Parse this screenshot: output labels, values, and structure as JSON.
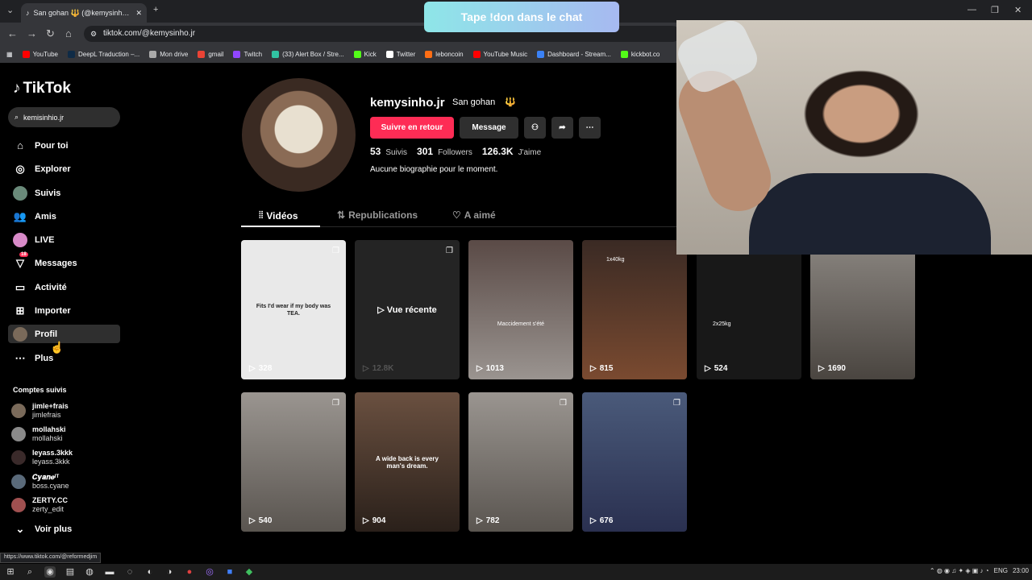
{
  "browser": {
    "tab_title": "San gohan 🔱 (@kemysinho.jr",
    "url": "tiktok.com/@kemysinho.jr",
    "bookmarks": [
      {
        "label": "YouTube",
        "color": "#ff0000"
      },
      {
        "label": "DeepL Traduction –...",
        "color": "#0f2b46"
      },
      {
        "label": "Mon drive",
        "color": "#aaaaaa"
      },
      {
        "label": "gmail",
        "color": "#ea4335"
      },
      {
        "label": "Twitch",
        "color": "#9146ff"
      },
      {
        "label": "(33) Alert Box / Stre...",
        "color": "#31c3a2"
      },
      {
        "label": "Kick",
        "color": "#53fc18"
      },
      {
        "label": "Twitter",
        "color": "#ffffff"
      },
      {
        "label": "leboncoin",
        "color": "#ff6e14"
      },
      {
        "label": "YouTube Music",
        "color": "#ff0000"
      },
      {
        "label": "Dashboard - Stream...",
        "color": "#3b82f6"
      },
      {
        "label": "kickbot.co",
        "color": "#53fc18"
      }
    ],
    "status_url": "https://www.tiktok.com/@reformedjim"
  },
  "overlay": {
    "chat_banner": "Tape !don dans le chat"
  },
  "sidebar": {
    "logo": "TikTok",
    "search_value": "kemisinhio.jr",
    "nav": [
      {
        "label": "Pour toi",
        "icon": "home-icon"
      },
      {
        "label": "Explorer",
        "icon": "compass-icon"
      },
      {
        "label": "Suivis",
        "icon": "avatar"
      },
      {
        "label": "Amis",
        "icon": "friends-icon"
      },
      {
        "label": "LIVE",
        "icon": "live-icon"
      },
      {
        "label": "Messages",
        "icon": "messages-icon",
        "badge": "18"
      },
      {
        "label": "Activité",
        "icon": "activity-icon"
      },
      {
        "label": "Importer",
        "icon": "upload-icon"
      },
      {
        "label": "Profil",
        "icon": "avatar"
      },
      {
        "label": "Plus",
        "icon": "more-icon"
      }
    ],
    "following_title": "Comptes suivis",
    "following": [
      {
        "name": "jimle+frais",
        "handle": "jimlefrais",
        "color": "#7a6a5a"
      },
      {
        "name": "mollahski",
        "handle": "mollahski",
        "color": "#8a8a8a"
      },
      {
        "name": "leyass.3kkk",
        "handle": "leyass.3kkk",
        "color": "#3a2a2a"
      },
      {
        "name": "𝑪𝒚𝒂𝒏𝒆ᴵᵀ",
        "handle": "boss.cyane",
        "color": "#5a6a7a"
      },
      {
        "name": "ZERTY.CC",
        "handle": "zerty_edit",
        "color": "#a05050"
      }
    ],
    "see_more": "Voir plus"
  },
  "profile": {
    "username": "kemysinho.jr",
    "nickname": "San gohan",
    "follow_button": "Suivre en retour",
    "message_button": "Message",
    "following_count": "53",
    "following_label": "Suivis",
    "followers_count": "301",
    "followers_label": "Followers",
    "likes_count": "126.3K",
    "likes_label": "J'aime",
    "bio": "Aucune biographie pour le moment.",
    "tabs": [
      {
        "label": "Vidéos",
        "icon": "grid-icon"
      },
      {
        "label": "Republications",
        "icon": "repost-icon"
      },
      {
        "label": "A aimé",
        "icon": "heart-icon"
      }
    ]
  },
  "videos": [
    {
      "views": "328",
      "caption": "Fits I'd wear if my body was TEA.",
      "bg": "#e9e9e9",
      "multi": true
    },
    {
      "views": "12.8K",
      "caption": "",
      "recent": "Vue récente",
      "bg": "#2a2a2a",
      "multi": true
    },
    {
      "views": "1013",
      "caption": "Maccidement s'été",
      "bg": "#8c8684",
      "multi": false
    },
    {
      "views": "815",
      "caption": "1x40kg",
      "bg": "#5a4036",
      "multi": false
    },
    {
      "views": "524",
      "caption": "2x25kg",
      "bg": "#1e1e1e",
      "multi": false
    },
    {
      "views": "1690",
      "caption": "",
      "bg": "#6d6a66",
      "multi": false
    },
    {
      "views": "540",
      "caption": "",
      "bg": "#7a7672",
      "multi": true
    },
    {
      "views": "904",
      "caption": "A wide back is every man's dream.",
      "bg": "#4a3a30",
      "multi": false
    },
    {
      "views": "782",
      "caption": "",
      "bg": "#7a7672",
      "multi": true
    },
    {
      "views": "676",
      "caption": "",
      "bg": "#3a4a6a",
      "multi": true
    }
  ],
  "taskbar": {
    "lang": "ENG",
    "time": "23:00"
  }
}
